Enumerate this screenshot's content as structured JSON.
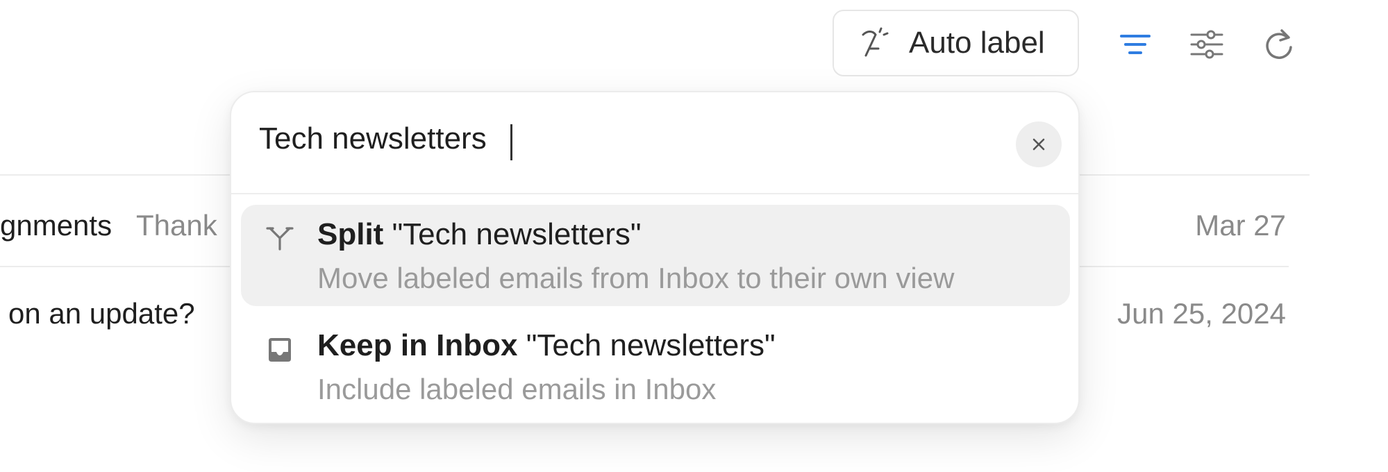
{
  "toolbar": {
    "auto_label": "Auto label",
    "icons": [
      "auto-label-icon",
      "filter-lines-icon",
      "sliders-icon",
      "refresh-icon"
    ],
    "accent_color": "#2f7de1"
  },
  "list": {
    "rows": [
      {
        "subject": "gnments",
        "snippet": "Thank",
        "date": "Mar 27"
      },
      {
        "subject": "on an update?",
        "snippet": "",
        "date": "Jun 25, 2024"
      }
    ]
  },
  "popover": {
    "search_value": "Tech newsletters",
    "options": [
      {
        "icon": "split-icon",
        "action": "Split",
        "target": "\"Tech newsletters\"",
        "description": "Move labeled emails from Inbox to their own view"
      },
      {
        "icon": "inbox-tray-icon",
        "action": "Keep in Inbox",
        "target": "\"Tech newsletters\"",
        "description": "Include labeled emails in Inbox"
      }
    ]
  }
}
